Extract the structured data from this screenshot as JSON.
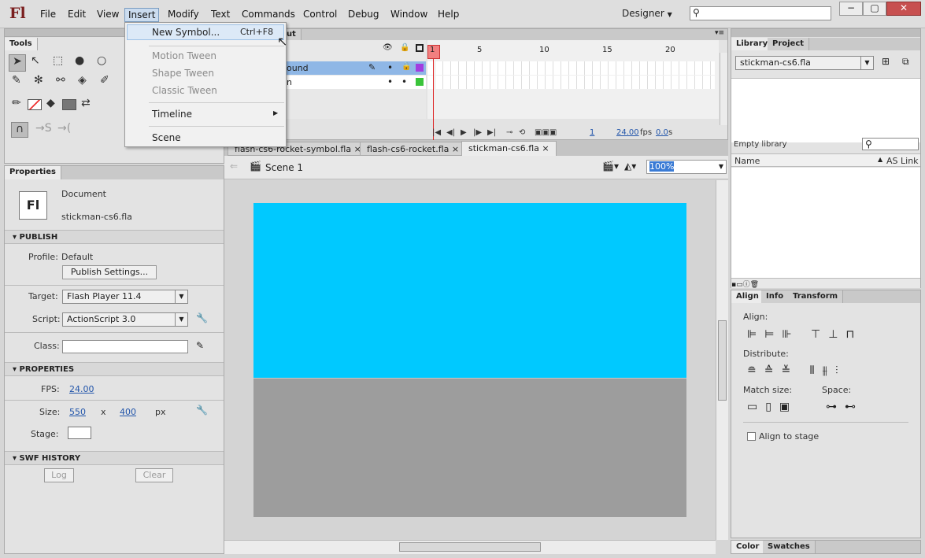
{
  "app": {
    "logo": "Fl"
  },
  "menubar": {
    "items": [
      "File",
      "Edit",
      "View",
      "Insert",
      "Modify",
      "Text",
      "Commands",
      "Control",
      "Debug",
      "Window",
      "Help"
    ],
    "workspace": "Designer",
    "active": "Insert"
  },
  "insert_menu": {
    "new_symbol": "New Symbol...",
    "new_symbol_shortcut": "Ctrl+F8",
    "motion_tween": "Motion Tween",
    "shape_tween": "Shape Tween",
    "classic_tween": "Classic Tween",
    "timeline": "Timeline",
    "scene": "Scene"
  },
  "tools": {
    "title": "Tools"
  },
  "timeline": {
    "tab_output": "tput",
    "layers": [
      "ound",
      "n"
    ],
    "ruler": [
      "1",
      "5",
      "10",
      "15",
      "20"
    ],
    "frame": "1",
    "fps": "24.00",
    "fps_unit": "fps",
    "time": "0.0",
    "time_unit": "s"
  },
  "documents": {
    "tabs": [
      "flash-cs6-rocket-symbol.fla",
      "flash-cs6-rocket.fla",
      "stickman-cs6.fla"
    ],
    "active": 2
  },
  "editbar": {
    "scene": "Scene 1",
    "zoom": "100%"
  },
  "stage": {
    "sky_color": "#00c9ff",
    "ground_color": "#9d9d9d"
  },
  "properties": {
    "tab": "Properties",
    "doc_type": "Document",
    "doc_name": "stickman-cs6.fla",
    "doc_icon": "Fl",
    "publish": {
      "title": "PUBLISH",
      "profile_label": "Profile:",
      "profile_value": "Default",
      "publish_settings": "Publish Settings...",
      "target_label": "Target:",
      "target_value": "Flash Player 11.4",
      "script_label": "Script:",
      "script_value": "ActionScript 3.0",
      "class_label": "Class:",
      "class_value": ""
    },
    "props": {
      "title": "PROPERTIES",
      "fps_label": "FPS:",
      "fps": "24.00",
      "size_label": "Size:",
      "width": "550",
      "x": "x",
      "height": "400",
      "unit": "px",
      "stage_label": "Stage:"
    },
    "swf": {
      "title": "SWF HISTORY",
      "log": "Log",
      "clear": "Clear"
    }
  },
  "library": {
    "tabs": [
      "Library",
      "Project"
    ],
    "file": "stickman-cs6.fla",
    "empty": "Empty library",
    "col_name": "Name",
    "col_link": "AS Link"
  },
  "align": {
    "tabs": [
      "Align",
      "Info",
      "Transform"
    ],
    "align_label": "Align:",
    "distribute_label": "Distribute:",
    "match_label": "Match size:",
    "space_label": "Space:",
    "to_stage": "Align to stage"
  },
  "bottom": {
    "tabs": [
      "Color",
      "Swatches"
    ]
  }
}
